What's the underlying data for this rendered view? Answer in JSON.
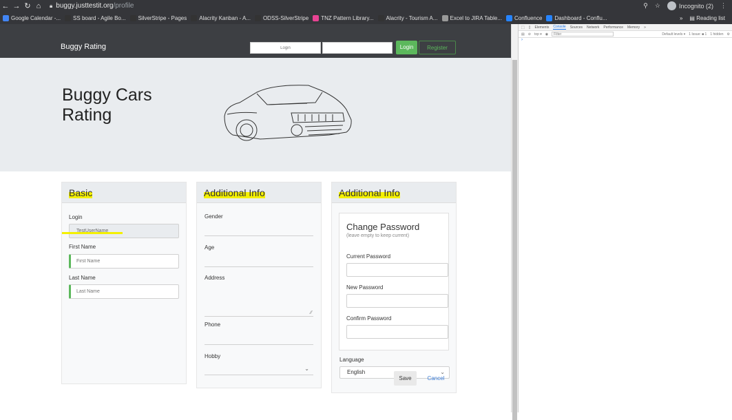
{
  "browser": {
    "url_host": "buggy.justtestit.org",
    "url_path": "/profile",
    "incognito_label": "Incognito (2)",
    "bookmarks": [
      {
        "label": "Google Calendar -...",
        "color": "#4285f4"
      },
      {
        "label": "SS board - Agile Bo...",
        "color": "#333333"
      },
      {
        "label": "SilverStripe - Pages",
        "color": "#333333"
      },
      {
        "label": "Alacrity Kanban - A...",
        "color": "#333333"
      },
      {
        "label": "ODSS-SilverStripe",
        "color": "#333333"
      },
      {
        "label": "TNZ Pattern Library...",
        "color": "#e84393"
      },
      {
        "label": "Alacrity - Tourism A...",
        "color": "#333333"
      },
      {
        "label": "Excel to JIRA Table...",
        "color": "#999999"
      },
      {
        "label": "Confluence",
        "color": "#2684ff"
      },
      {
        "label": "Dashboard - Conflu...",
        "color": "#2684ff"
      }
    ],
    "reading_list": "Reading list",
    "more_bookmarks": "»"
  },
  "devtools": {
    "tabs": [
      "Elements",
      "Console",
      "Sources",
      "Network",
      "Performance",
      "Memory",
      "»"
    ],
    "active_tab": "Console",
    "context": "top ▾",
    "filter_placeholder": "Filter",
    "levels": "Default levels ▾",
    "issues": "1 Issue: ■ 1",
    "hidden": "1 hidden",
    "prompt": "›"
  },
  "site": {
    "brand": "Buggy Rating",
    "login_placeholder": "Login",
    "login_button": "Login",
    "register_button": "Register",
    "hero_title": "Buggy Cars Rating"
  },
  "basic": {
    "heading": "Basic",
    "login_label": "Login",
    "login_value": "TestUserName",
    "first_name_label": "First Name",
    "first_name_placeholder": "First Name",
    "last_name_label": "Last Name",
    "last_name_placeholder": "Last Name"
  },
  "additional": {
    "heading": "Additional Info",
    "gender_label": "Gender",
    "age_label": "Age",
    "address_label": "Address",
    "phone_label": "Phone",
    "hobby_label": "Hobby"
  },
  "password": {
    "heading": "Additional Info",
    "title": "Change Password",
    "subtitle": "(leave empty to keep current)",
    "current_label": "Current Password",
    "new_label": "New Password",
    "confirm_label": "Confirm Password",
    "language_label": "Language",
    "language_value": "English"
  },
  "actions": {
    "save": "Save",
    "cancel": "Cancel"
  },
  "colors": {
    "highlight": "#f4f000",
    "accent_green": "#5cb85c",
    "nav_bg": "#3d3f43"
  }
}
